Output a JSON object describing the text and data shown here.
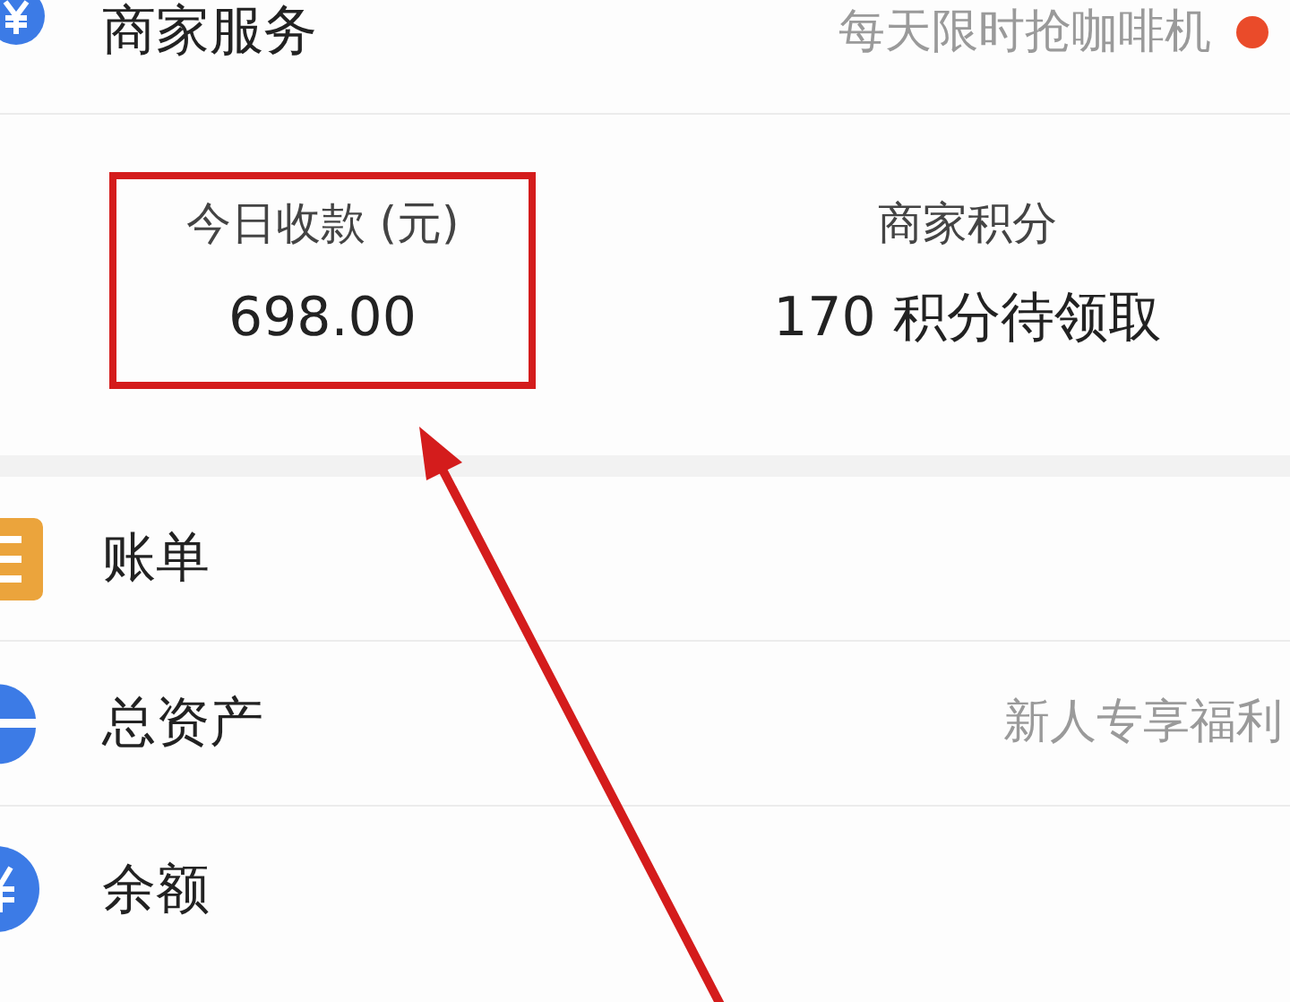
{
  "merchant_row": {
    "label": "商家服务",
    "promo": "每天限时抢咖啡机",
    "has_dot": true
  },
  "stats": [
    {
      "label": "今日收款 (元)",
      "value": "698.00",
      "highlighted": true
    },
    {
      "label": "商家积分",
      "value": "170 积分待领取",
      "highlighted": false
    }
  ],
  "menu": [
    {
      "kind": "bill",
      "label": "账单"
    },
    {
      "kind": "assets",
      "label": "总资产",
      "note": "新人专享福利"
    },
    {
      "kind": "balance",
      "label": "余额"
    }
  ]
}
